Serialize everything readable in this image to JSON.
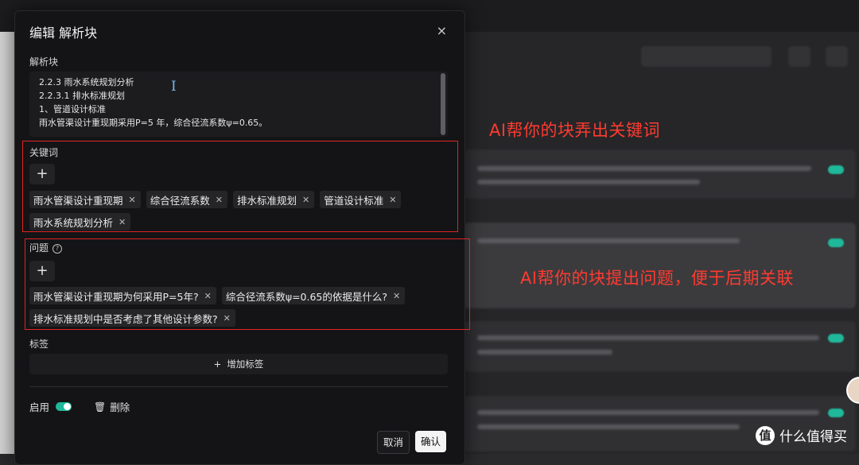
{
  "modal": {
    "title": "编辑 解析块",
    "close_icon": "×",
    "content_label": "解析块",
    "content_lines": [
      "2.2.3 雨水系统规划分析",
      "2.2.3.1 排水标准规划",
      "1、管道设计标准",
      "雨水管渠设计重现期采用P=5 年，综合径流系数ψ=0.65。"
    ],
    "keywords_label": "关键词",
    "add_symbol": "+",
    "keywords": [
      "雨水管渠设计重现期",
      "综合径流系数",
      "排水标准规划",
      "管道设计标准",
      "雨水系统规划分析"
    ],
    "questions_label": "问题",
    "questions": [
      "雨水管渠设计重现期为何采用P=5年?",
      "综合径流系数ψ=0.65的依据是什么?",
      "排水标准规划中是否考虑了其他设计参数?"
    ],
    "tags_label": "标签",
    "add_tag_label": "增加标签",
    "enable_label": "启用",
    "delete_label": "删除",
    "cancel_label": "取消",
    "confirm_label": "确认"
  },
  "annotations": {
    "keywords_note": "AI帮你的块弄出关键词",
    "questions_note": "AI帮你的块提出问题，便于后期关联"
  },
  "watermark": {
    "logo": "值",
    "text": "什么值得买"
  },
  "colors": {
    "accent_toggle": "#1fb89a",
    "annotation_red": "#e02424",
    "modal_bg": "#141416"
  }
}
